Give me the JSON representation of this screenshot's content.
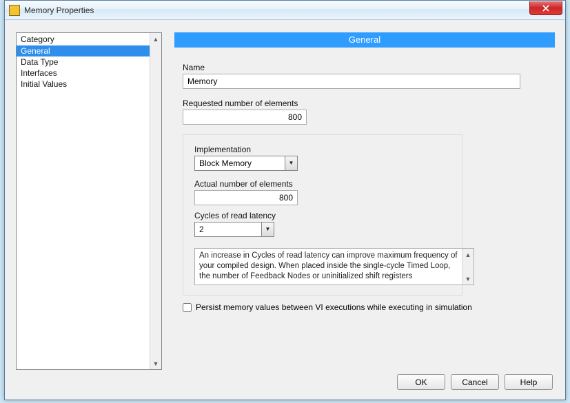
{
  "window": {
    "title": "Memory Properties"
  },
  "sidebar": {
    "header": "Category",
    "items": [
      {
        "label": "General",
        "selected": true
      },
      {
        "label": "Data Type",
        "selected": false
      },
      {
        "label": "Interfaces",
        "selected": false
      },
      {
        "label": "Initial Values",
        "selected": false
      }
    ]
  },
  "panel": {
    "title": "General",
    "name_label": "Name",
    "name_value": "Memory",
    "requested_label": "Requested number of elements",
    "requested_value": "800",
    "implementation_label": "Implementation",
    "implementation_value": "Block Memory",
    "actual_label": "Actual number of elements",
    "actual_value": "800",
    "latency_label": "Cycles of read latency",
    "latency_value": "2",
    "info_text": "An increase in Cycles of read latency can improve maximum frequency of your compiled design. When placed inside the single-cycle Timed Loop, the number of Feedback Nodes or uninitialized shift registers",
    "persist_label": "Persist memory values between VI executions while executing in simulation",
    "persist_checked": false
  },
  "buttons": {
    "ok": "OK",
    "cancel": "Cancel",
    "help": "Help"
  }
}
